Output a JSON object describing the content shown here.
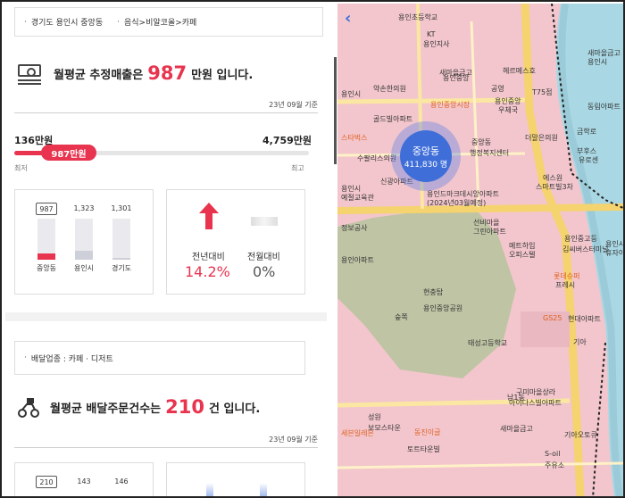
{
  "location": {
    "region": "경기도 용인시 중앙동",
    "category": "음식>비알코올>카페"
  },
  "sales": {
    "title_prefix": "월평균 추정매출은",
    "value": "987",
    "title_suffix": "만원 입니다.",
    "basis": "23년 09월 기준",
    "range_min": "136만원",
    "range_max": "4,759만원",
    "current": "987만원",
    "position_fraction": 0.19,
    "low_label": "최저",
    "high_label": "최고",
    "bars": [
      {
        "label": "중앙동",
        "value": "987",
        "fill_fraction": 0.16,
        "color": "#e8344e",
        "boxed": true
      },
      {
        "label": "용인시",
        "value": "1,323",
        "fill_fraction": 0.22,
        "color": "#cdd0d8",
        "boxed": false
      },
      {
        "label": "경기도",
        "value": "1,301",
        "fill_fraction": 0.05,
        "color": "#cdd0d8",
        "boxed": false
      }
    ],
    "yoy_label": "전년대비",
    "yoy_value": "14.2%",
    "mom_label": "전월대비",
    "mom_value": "0%"
  },
  "delivery": {
    "category": "배달업종 : 카페 · 디저트",
    "title_prefix": "월평균 배달주문건수는",
    "value": "210",
    "title_suffix": "건 입니다.",
    "basis": "23년 09월 기준",
    "bars": [
      {
        "value": "210",
        "boxed": true
      },
      {
        "value": "143",
        "boxed": false
      },
      {
        "value": "146",
        "boxed": false
      }
    ]
  },
  "map": {
    "back_icon": "chevron-left-icon",
    "cluster_name": "중앙동",
    "cluster_count": "411,830 명",
    "labels": [
      "용인초등학교",
      "KT",
      "용인지사",
      "새마을금고",
      "헤르메스호",
      "약손한의원",
      "공영",
      "T75점",
      "용인중앙시장",
      "용인중앙",
      "우체국",
      "골드빌아파트",
      "스타벅스",
      "수팔리스의원",
      "신광아파트",
      "중앙동",
      "행정복지센터",
      "더말은의원",
      "에스원",
      "스마트빌3차",
      "용인드마크데시앙아파트",
      "(2024년03월예정)",
      "정보공사",
      "선비마을",
      "그린아파트",
      "메트하임",
      "오피스텔",
      "용인중고등",
      "김씨버스터미널",
      "용인아파트",
      "현충탑",
      "용인중앙공원",
      "롯데슈퍼",
      "프레시",
      "GS25",
      "현대아파트",
      "태성고등학교",
      "기아",
      "구미마을상라",
      "아이다스빌아파트",
      "남1동",
      "새마을금고",
      "기아오토큐",
      "세븐일레븐",
      "동진이글",
      "토트타운빌",
      "S-oil",
      "주유소",
      "성원",
      "보모스타운",
      "용인시",
      "새마을금고",
      "용인시",
      "동림아파트",
      "금학로",
      "부후스",
      "유로센",
      "용인시",
      "예절교육관",
      "용인시",
      "휴자이",
      "용인중앙",
      "숲쪽"
    ]
  },
  "colors": {
    "accent": "#e8344e",
    "cluster": "#3f6ed9",
    "map_bg": "#f2c6cc"
  }
}
